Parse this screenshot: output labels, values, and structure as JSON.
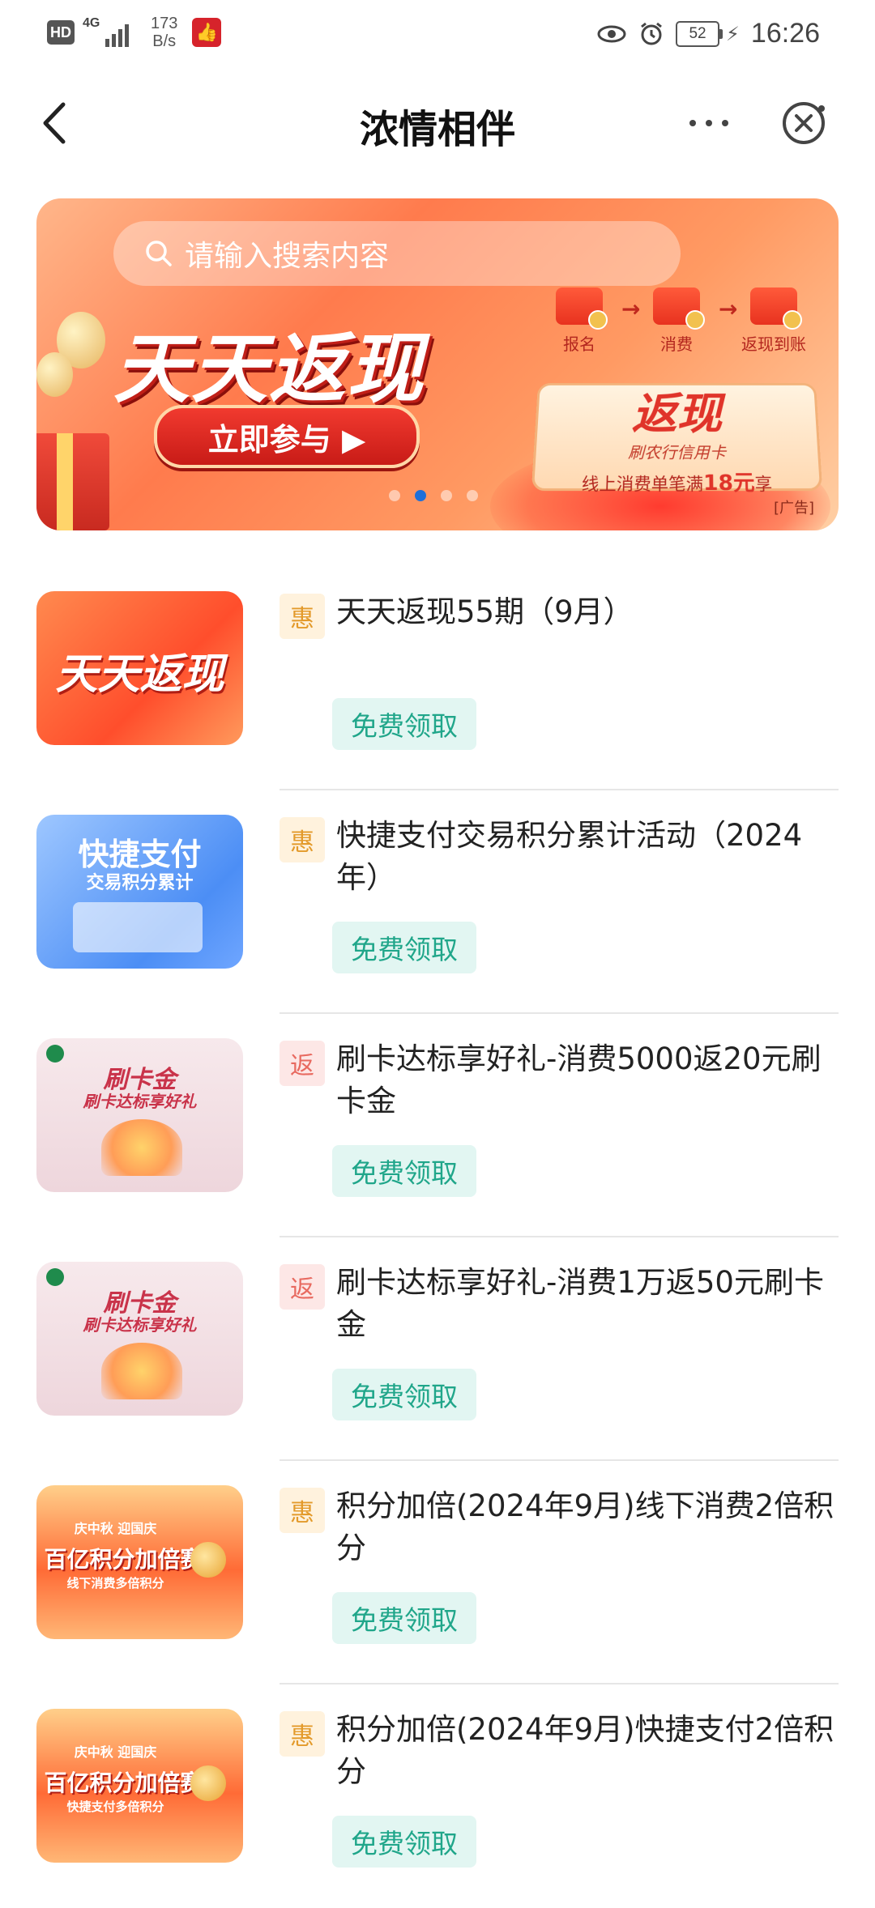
{
  "status_bar": {
    "hd": "HD",
    "network": "4G",
    "speed_value": "173",
    "speed_unit": "B/s",
    "battery": "52",
    "time": "16:26"
  },
  "header": {
    "title": "浓情相伴"
  },
  "banner": {
    "search_placeholder": "请输入搜索内容",
    "headline": "天天返现",
    "cta": "立即参与 ▶",
    "steps": [
      "报名",
      "消费",
      "返现到账"
    ],
    "plaque_big": "返现",
    "plaque_sub": "刷农行信用卡",
    "plaque_line_prefix": "线上消费单笔满",
    "plaque_line_amount": "18元",
    "plaque_line_suffix": "享",
    "ad_tag": "[广告]",
    "page_count": 4,
    "active_page": 2
  },
  "items": [
    {
      "tag": "惠",
      "tag_type": "hui",
      "title": "天天返现55期（9月）",
      "button": "免费领取",
      "thumb_text": "天天返现"
    },
    {
      "tag": "惠",
      "tag_type": "hui",
      "title": "快捷支付交易积分累计活动（2024年）",
      "button": "免费领取",
      "thumb_text": "快捷支付",
      "thumb_sub": "交易积分累计"
    },
    {
      "tag": "返",
      "tag_type": "fan",
      "title": "刷卡达标享好礼-消费5000返20元刷卡金",
      "button": "免费领取",
      "thumb_text": "刷卡金",
      "thumb_sub": "刷卡达标享好礼"
    },
    {
      "tag": "返",
      "tag_type": "fan",
      "title": "刷卡达标享好礼-消费1万返50元刷卡金",
      "button": "免费领取",
      "thumb_text": "刷卡金",
      "thumb_sub": "刷卡达标享好礼"
    },
    {
      "tag": "惠",
      "tag_type": "hui",
      "title": "积分加倍(2024年9月)线下消费2倍积分",
      "button": "免费领取",
      "thumb_text": "百亿积分加倍赛",
      "thumb_sub": "线下消费多倍积分",
      "thumb_top": "庆中秋 迎国庆"
    },
    {
      "tag": "惠",
      "tag_type": "hui",
      "title": "积分加倍(2024年9月)快捷支付2倍积分",
      "button": "免费领取",
      "thumb_text": "百亿积分加倍赛",
      "thumb_sub": "快捷支付多倍积分",
      "thumb_top": "庆中秋 迎国庆"
    }
  ],
  "colors": {
    "claim_bg": "#e2f6f2",
    "claim_text": "#20a68a",
    "hui_tag": "#e39a2b",
    "fan_tag": "#e86a60",
    "banner_accent": "#ff7b4d"
  }
}
